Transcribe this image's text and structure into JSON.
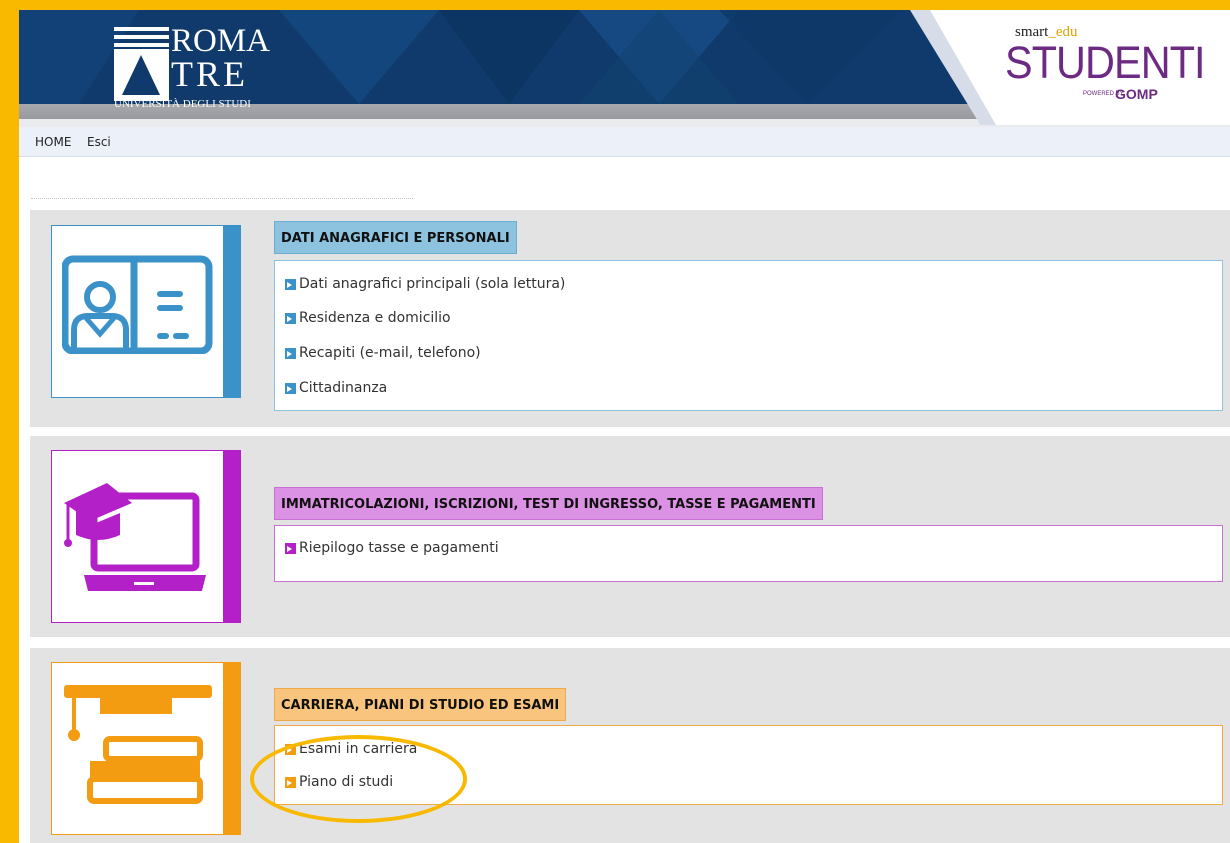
{
  "header": {
    "university_logo": {
      "line1": "ROMA",
      "line2": "TRE",
      "subtitle": "UNIVERSITÀ DEGLI STUDI"
    },
    "brand": {
      "smart": "smart",
      "edu": "_edu",
      "name": "STUDENTI",
      "powered_by": "POWERED BY",
      "vendor": "GOMP"
    }
  },
  "nav": {
    "home": "HOME",
    "logout": "Esci"
  },
  "sections": [
    {
      "title": "DATI ANAGRAFICI E PERSONALI",
      "color": "#3a92c8",
      "header_bg": "#8ec3e0",
      "icon": "id-card-icon",
      "links": [
        "Dati anagrafici principali (sola lettura)",
        "Residenza e domicilio",
        "Recapiti (e-mail, telefono)",
        "Cittadinanza"
      ]
    },
    {
      "title": "IMMATRICOLAZIONI, ISCRIZIONI, TEST DI INGRESSO, TASSE E PAGAMENTI",
      "color": "#b420c8",
      "header_bg": "#dc92e4",
      "icon": "graduation-laptop-icon",
      "links": [
        "Riepilogo tasse e pagamenti"
      ]
    },
    {
      "title": "CARRIERA, PIANI DI STUDIO ED ESAMI",
      "color": "#f39c12",
      "header_bg": "#f9c57e",
      "icon": "books-graduation-icon",
      "links": [
        "Esami in carriera",
        "Piano di studi"
      ]
    }
  ],
  "frame_color": "#f8b900"
}
